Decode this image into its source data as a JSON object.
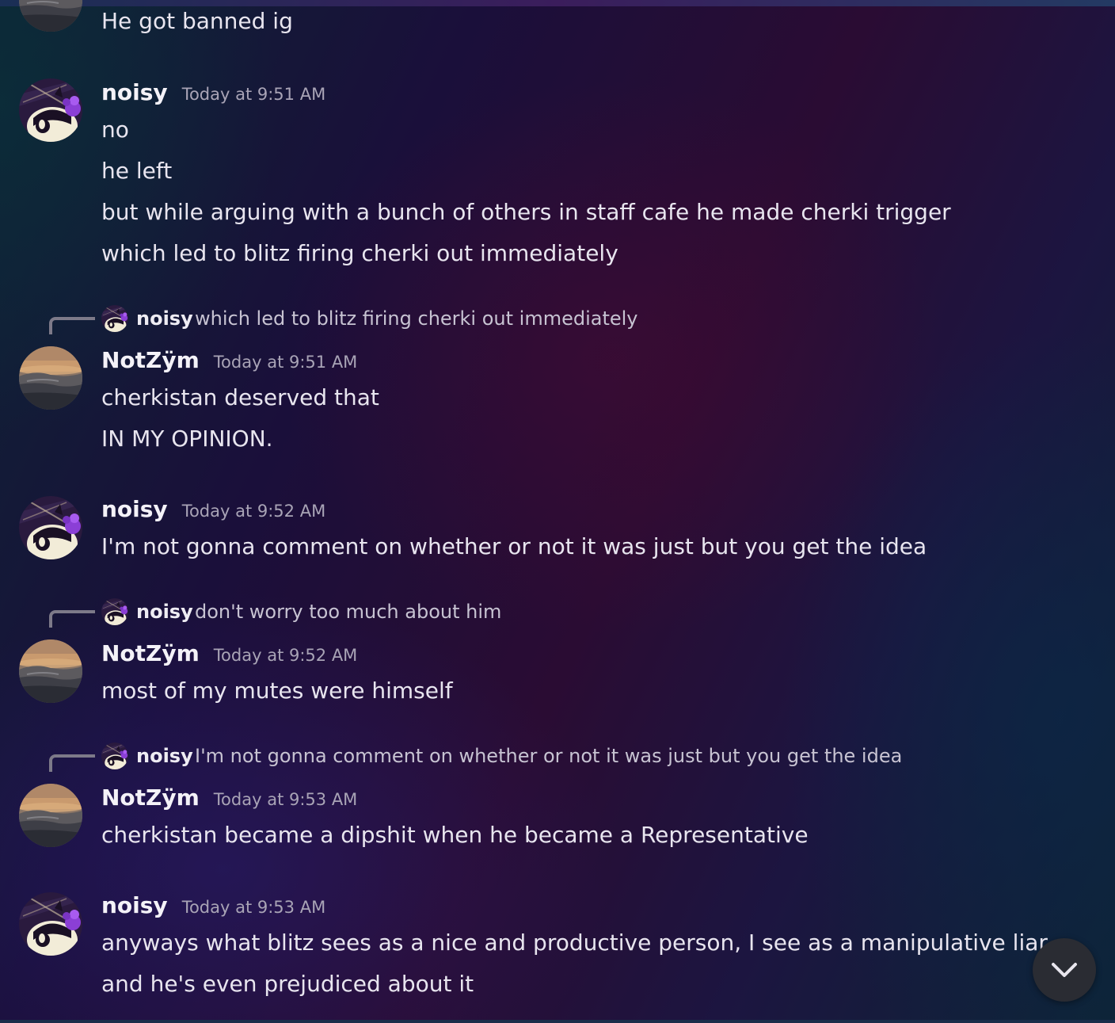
{
  "messages": [
    {
      "lines": [
        "He got banned ig"
      ]
    },
    {
      "author": "noisy",
      "timestamp": "Today at 9:51 AM",
      "lines": [
        "no",
        "he left",
        "but while arguing with a bunch of others in staff cafe he made cherki trigger",
        "which led to blitz firing cherki out immediately"
      ]
    },
    {
      "reply_to": {
        "author": "noisy",
        "text": "which led to blitz firing cherki out immediately"
      },
      "author": "NotZÿm",
      "timestamp": "Today at 9:51 AM",
      "lines": [
        "cherkistan deserved that",
        "IN MY OPINION."
      ]
    },
    {
      "author": "noisy",
      "timestamp": "Today at 9:52 AM",
      "lines": [
        "I'm not gonna comment on whether or not it was just but you get the idea"
      ]
    },
    {
      "reply_to": {
        "author": "noisy",
        "text": "don't worry too much about him"
      },
      "author": "NotZÿm",
      "timestamp": "Today at 9:52 AM",
      "lines": [
        "most of my mutes were himself"
      ]
    },
    {
      "reply_to": {
        "author": "noisy",
        "text": "I'm not gonna comment on whether or not it was just but you get the idea"
      },
      "author": "NotZÿm",
      "timestamp": "Today at 9:53 AM",
      "lines": [
        "cherkistan became a dipshit when he became a Representative"
      ]
    },
    {
      "author": "noisy",
      "timestamp": "Today at 9:53 AM",
      "lines": [
        "anyways what blitz sees as a nice and productive person, I see as a manipulative liar",
        "and he's even prejudiced about it"
      ]
    }
  ],
  "icons": {
    "noisy_avatar": "purple-cat-avatar-icon",
    "notzym_avatar": "sunset-landscape-avatar-icon",
    "scroll": "chevron-down-icon"
  },
  "colors": {
    "username": "#f4f2f8",
    "timestamp": "#a9a4b6",
    "reply_spine": "#7d7a89",
    "scroll_button": "#2a2c33"
  }
}
